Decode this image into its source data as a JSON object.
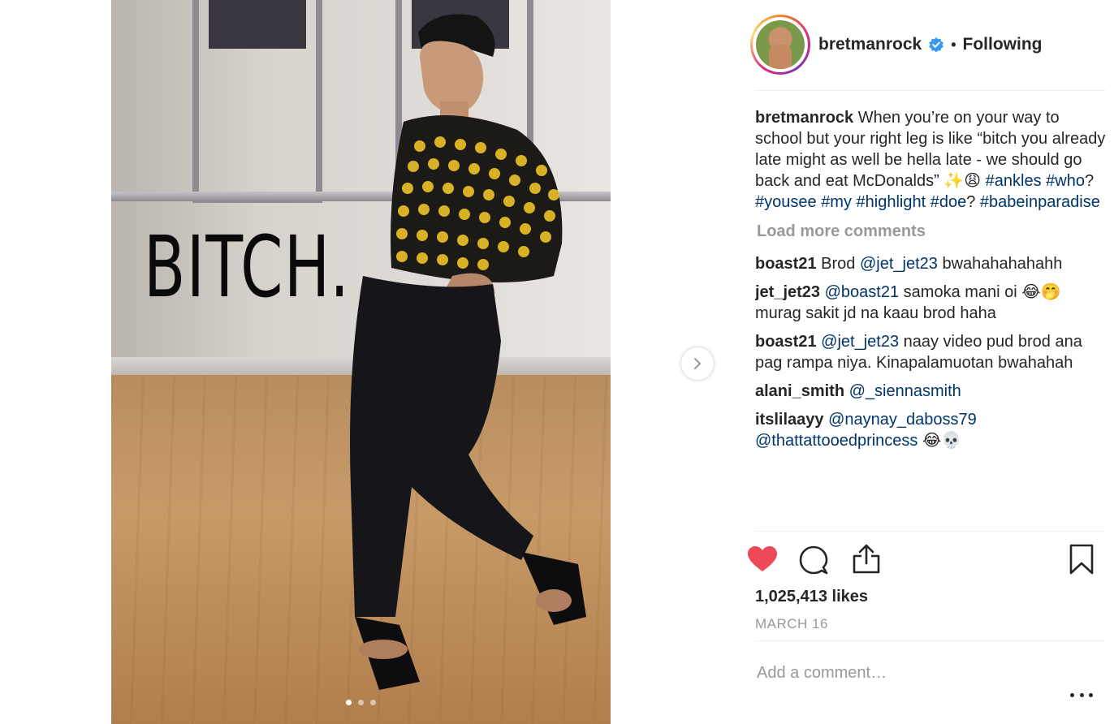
{
  "post": {
    "story_overlay_text": "BITCH.",
    "carousel": {
      "count": 3,
      "active_index": 0
    }
  },
  "header": {
    "username": "bretmanrock",
    "verified_icon": "verified-badge-icon",
    "separator": "•",
    "follow_status": "Following"
  },
  "caption": {
    "username": "bretmanrock",
    "text": "When you’re on your way to school but your right leg is like “bitch you already late might as well be hella late - we should go back and eat McDonalds” ✨😩 ",
    "tags": [
      "#ankles",
      "#who",
      "#yousee",
      "#my",
      "#highlight",
      "#doe",
      "#babeinparadise"
    ]
  },
  "load_more": "Load more comments",
  "comments": [
    {
      "username": "boast21",
      "pre": "Brod ",
      "mention": "@jet_jet23",
      "post": " bwahahahahahh"
    },
    {
      "username": "jet_jet23",
      "pre": "",
      "mention": "@boast21",
      "post": " samoka mani oi 😂🤭 murag sakit jd na kaau brod haha"
    },
    {
      "username": "boast21",
      "pre": "",
      "mention": "@jet_jet23",
      "post": " naay video pud brod ana pag rampa niya. Kinapalamuotan bwahahah"
    },
    {
      "username": "alani_smith",
      "pre": "",
      "mention": "@_siennasmith",
      "post": ""
    },
    {
      "username": "itslilaayy",
      "pre": "",
      "mention": "@naynay_daboss79",
      "mention2": "@thattattooedprincess",
      "post": " 😂💀"
    }
  ],
  "stats": {
    "likes": "1,025,413 likes",
    "date": "MARCH 16"
  },
  "add_comment": {
    "placeholder": "Add a comment…"
  },
  "icons": {
    "like": "heart-icon",
    "comment": "comment-icon",
    "share": "share-icon",
    "save": "bookmark-icon",
    "more": "more-icon",
    "next": "chevron-right-icon"
  },
  "colors": {
    "liked_heart": "#ed4956",
    "link": "#003569",
    "muted": "#999999",
    "verified": "#3897f0"
  }
}
